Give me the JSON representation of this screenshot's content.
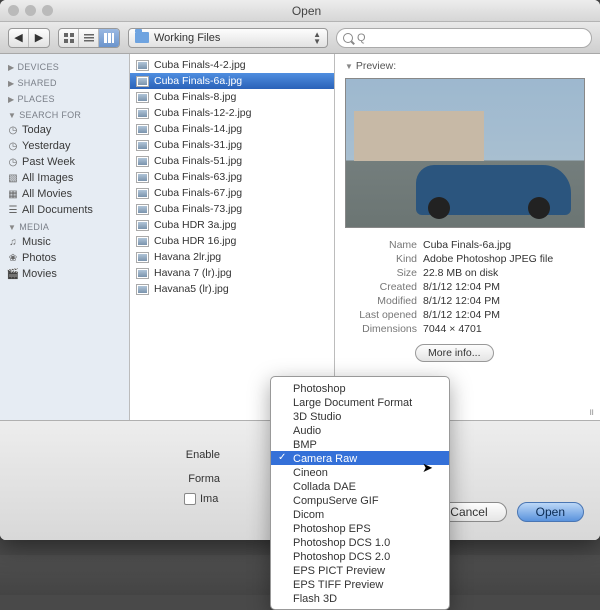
{
  "window_title": "Open",
  "toolbar": {
    "path_label": "Working Files",
    "search_placeholder": "Q"
  },
  "sidebar": {
    "sections": [
      {
        "label": "DEVICES",
        "expanded": false,
        "items": []
      },
      {
        "label": "SHARED",
        "expanded": false,
        "items": []
      },
      {
        "label": "PLACES",
        "expanded": false,
        "items": []
      },
      {
        "label": "SEARCH FOR",
        "expanded": true,
        "items": [
          {
            "label": "Today",
            "icon": "clock-icon"
          },
          {
            "label": "Yesterday",
            "icon": "clock-icon"
          },
          {
            "label": "Past Week",
            "icon": "clock-icon"
          },
          {
            "label": "All Images",
            "icon": "image-icon"
          },
          {
            "label": "All Movies",
            "icon": "movie-icon"
          },
          {
            "label": "All Documents",
            "icon": "document-icon"
          }
        ]
      },
      {
        "label": "MEDIA",
        "expanded": true,
        "items": [
          {
            "label": "Music",
            "icon": "music-icon"
          },
          {
            "label": "Photos",
            "icon": "photos-icon"
          },
          {
            "label": "Movies",
            "icon": "movies-icon"
          }
        ]
      }
    ]
  },
  "files": [
    {
      "name": "Cuba Finals-4-2.jpg",
      "selected": false
    },
    {
      "name": "Cuba Finals-6a.jpg",
      "selected": true
    },
    {
      "name": "Cuba Finals-8.jpg",
      "selected": false
    },
    {
      "name": "Cuba Finals-12-2.jpg",
      "selected": false
    },
    {
      "name": "Cuba Finals-14.jpg",
      "selected": false
    },
    {
      "name": "Cuba Finals-31.jpg",
      "selected": false
    },
    {
      "name": "Cuba Finals-51.jpg",
      "selected": false
    },
    {
      "name": "Cuba Finals-63.jpg",
      "selected": false
    },
    {
      "name": "Cuba Finals-67.jpg",
      "selected": false
    },
    {
      "name": "Cuba Finals-73.jpg",
      "selected": false
    },
    {
      "name": "Cuba HDR 3a.jpg",
      "selected": false
    },
    {
      "name": "Cuba HDR 16.jpg",
      "selected": false
    },
    {
      "name": "Havana 2lr.jpg",
      "selected": false
    },
    {
      "name": "Havana 7 (lr).jpg",
      "selected": false
    },
    {
      "name": "Havana5 (lr).jpg",
      "selected": false
    }
  ],
  "preview": {
    "header": "Preview:",
    "meta": [
      {
        "k": "Name",
        "v": "Cuba Finals-6a.jpg"
      },
      {
        "k": "Kind",
        "v": "Adobe Photoshop JPEG file"
      },
      {
        "k": "Size",
        "v": "22.8 MB on disk"
      },
      {
        "k": "Created",
        "v": "8/1/12 12:04 PM"
      },
      {
        "k": "Modified",
        "v": "8/1/12 12:04 PM"
      },
      {
        "k": "Last opened",
        "v": "8/1/12 12:04 PM"
      },
      {
        "k": "Dimensions",
        "v": "7044 × 4701"
      }
    ],
    "more_info": "More info..."
  },
  "footer": {
    "enable_label": "Enable",
    "format_label": "Forma",
    "image_seq_label": "Ima",
    "cancel": "Cancel",
    "open": "Open"
  },
  "popup": {
    "options": [
      "Photoshop",
      "Large Document Format",
      "3D Studio",
      "Audio",
      "BMP",
      "Camera Raw",
      "Cineon",
      "Collada DAE",
      "CompuServe GIF",
      "Dicom",
      "Photoshop EPS",
      "Photoshop DCS 1.0",
      "Photoshop DCS 2.0",
      "EPS PICT Preview",
      "EPS TIFF Preview",
      "Flash 3D"
    ],
    "selected_index": 5
  }
}
